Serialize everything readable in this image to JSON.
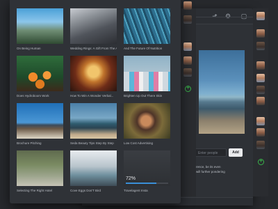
{
  "gallery": {
    "cards": [
      {
        "caption": "On Being Human"
      },
      {
        "caption": "Wedding Rings: A Gift From The Art"
      },
      {
        "caption": "And The Future Of Nutrition"
      },
      {
        "caption": "Does Hydroboom Work"
      },
      {
        "caption": "How To Win A Wonder Verbal..."
      },
      {
        "caption": "Brighten Up Out There Skin"
      },
      {
        "caption": "Brochure Pitching"
      },
      {
        "caption": "Seda Beauty Tips Step By Step"
      },
      {
        "caption": "Low Cost Advertising"
      },
      {
        "caption": "Selecting The Right Hotel"
      },
      {
        "caption": "Cove Eggs Dos'T Bird"
      },
      {
        "caption": "Travelagent Insta",
        "progress_label": "72%",
        "progress": 0.72
      }
    ]
  },
  "detail": {
    "people_placeholder": "Enter people",
    "add_label": "Add",
    "comment_lines": [
      "rence, be its even",
      "will further pondering",
      ""
    ]
  },
  "colors": {
    "accent": "#39b34a",
    "progress": "#3a8fd8"
  }
}
